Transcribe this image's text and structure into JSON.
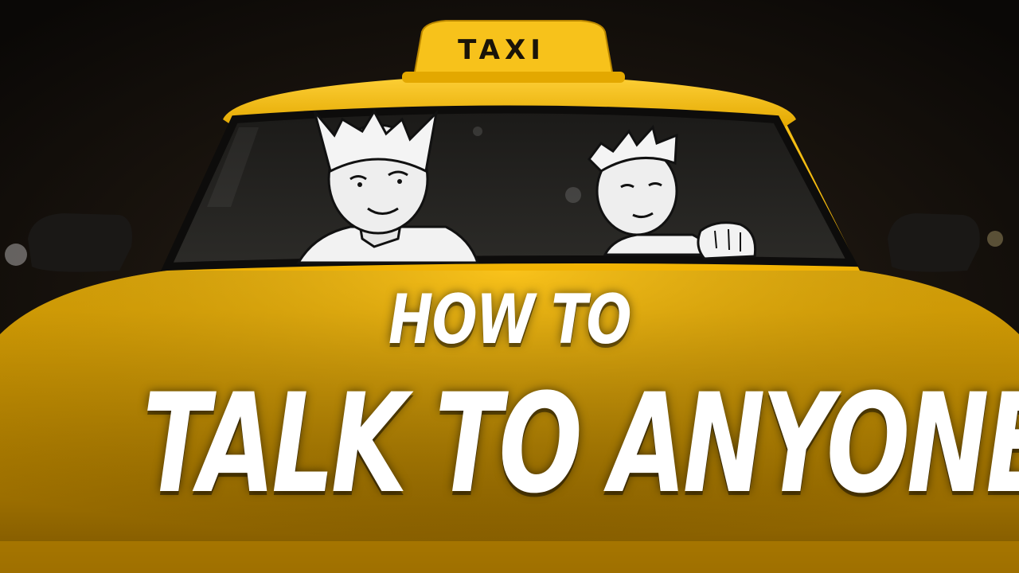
{
  "roof_sign": {
    "text": "TAXI"
  },
  "headline": {
    "line1": "HOW TO",
    "line2": "TALK TO ANYONE"
  },
  "colors": {
    "taxi_yellow": "#f2b705",
    "background": "#0b0907",
    "headline_text": "#ffffff"
  }
}
